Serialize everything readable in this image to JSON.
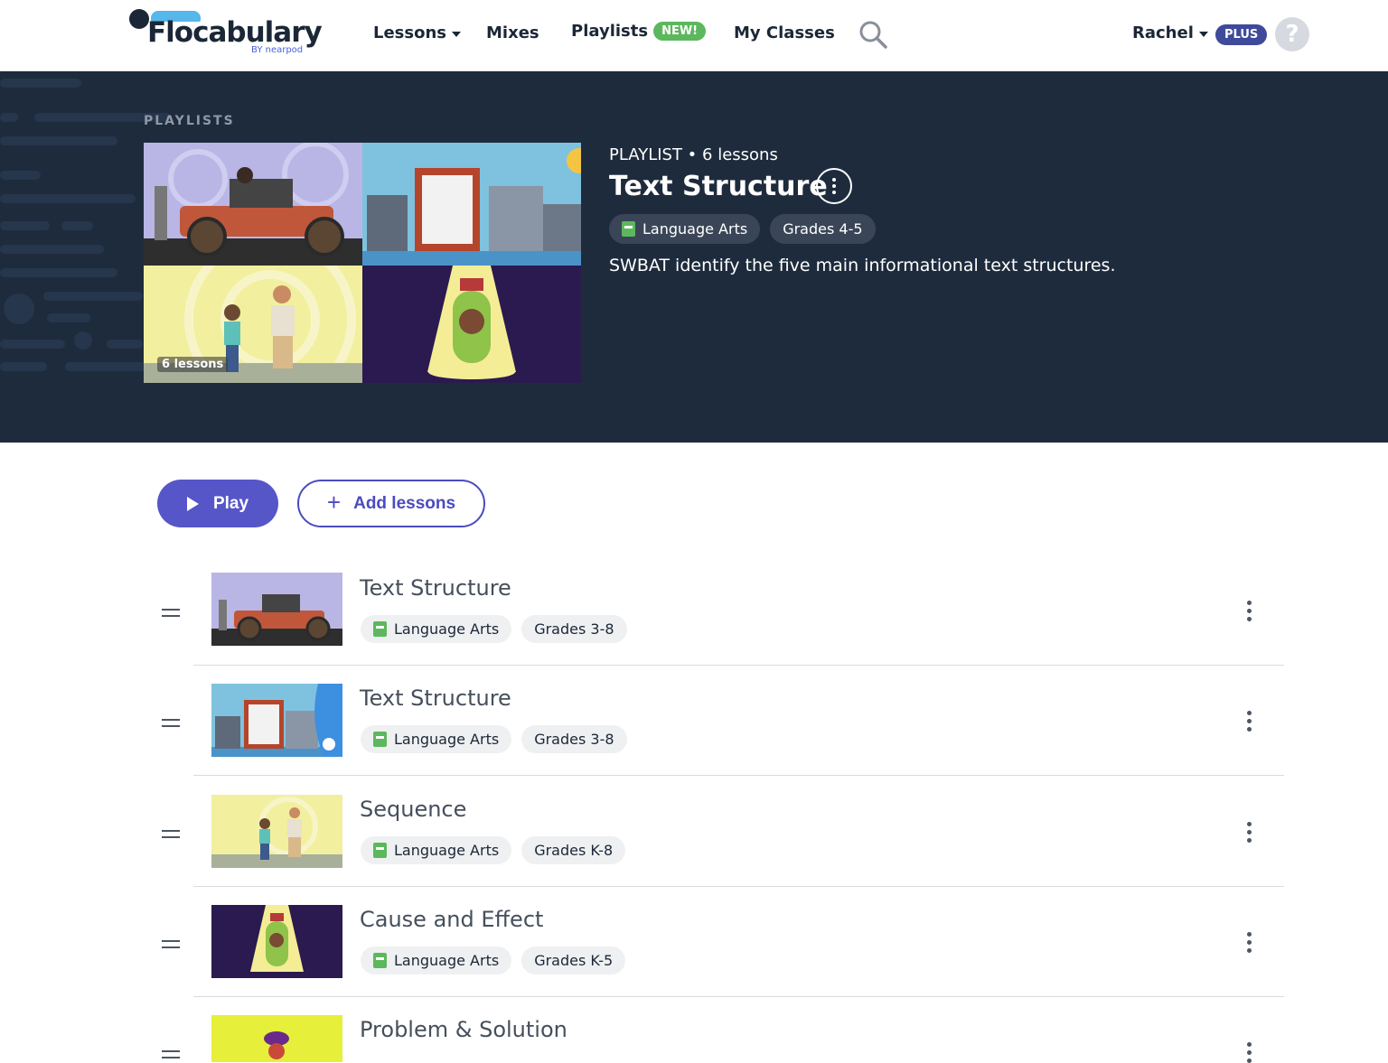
{
  "nav": {
    "brand": "Flocabulary",
    "brand_sub": "BY nearpod",
    "lessons": "Lessons",
    "mixes": "Mixes",
    "playlists": "Playlists",
    "new_badge": "NEW!",
    "my_classes": "My Classes",
    "user": "Rachel",
    "plan_badge": "PLUS",
    "help": "?"
  },
  "hero": {
    "breadcrumb": "PLAYLISTS",
    "collage_overlay": "6 lessons",
    "meta": "PLAYLIST • 6 lessons",
    "title": "Text Structure",
    "tags": [
      "Language Arts",
      "Grades 4-5"
    ],
    "description": "SWBAT identify the five main informational text structures."
  },
  "actions": {
    "play": "Play",
    "add": "Add lessons"
  },
  "lessons": [
    {
      "title": "Text Structure",
      "subject": "Language Arts",
      "grades": "Grades 3-8"
    },
    {
      "title": "Text Structure",
      "subject": "Language Arts",
      "grades": "Grades 3-8"
    },
    {
      "title": "Sequence",
      "subject": "Language Arts",
      "grades": "Grades K-8"
    },
    {
      "title": "Cause and Effect",
      "subject": "Language Arts",
      "grades": "Grades K-5"
    },
    {
      "title": "Problem & Solution",
      "subject": "",
      "grades": ""
    }
  ],
  "colors": {
    "hero_bg": "#1e2b3d",
    "accent": "#5656c9",
    "new_green": "#5cb85c",
    "plus_badge": "#3f4a9b"
  }
}
